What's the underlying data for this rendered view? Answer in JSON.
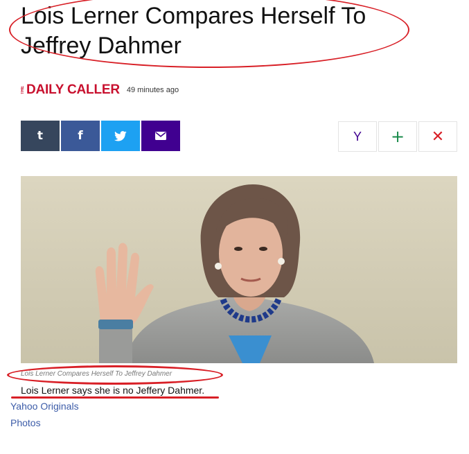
{
  "article": {
    "headline": "Lois Lerner Compares Herself To Jeffrey Dahmer",
    "publisher": {
      "logo_small": "THE",
      "logo_text": "DAILY CALLER"
    },
    "timestamp": "49 minutes ago",
    "image_caption": "Lois Lerner Compares Herself To Jeffrey Dahmer",
    "subline": "Lois Lerner says she is no Jeffery Dahmer."
  },
  "share": {
    "buttons": [
      {
        "label": "t",
        "icon": "tumblr-icon",
        "color": "#36465d"
      },
      {
        "label": "f",
        "icon": "facebook-icon",
        "color": "#3b5998"
      },
      {
        "label": "twitter",
        "icon": "twitter-icon",
        "color": "#1da1f2"
      },
      {
        "label": "mail",
        "icon": "mail-icon",
        "color": "#400090"
      }
    ]
  },
  "actions": {
    "yahoo_label": "Y",
    "add_label": "+",
    "close_label": "✕",
    "colors": {
      "yahoo": "#400090",
      "add": "#188a4a",
      "close": "#d81f26"
    }
  },
  "links": {
    "source": "Yahoo Originals",
    "photos": "Photos"
  },
  "annotations": {
    "color": "#d81f26"
  }
}
